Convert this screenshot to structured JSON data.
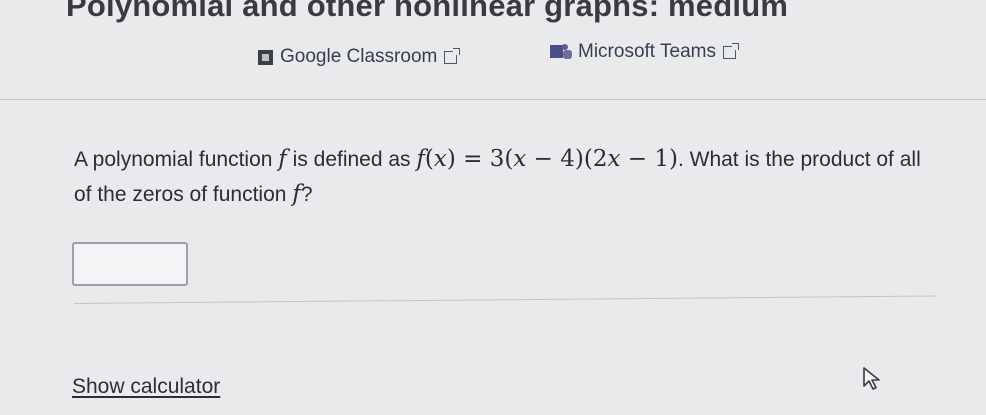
{
  "header": {
    "title": "Polynomial and other nonlinear graphs: medium"
  },
  "share": {
    "classroom": {
      "label": "Google Classroom",
      "icon": "google-classroom-icon"
    },
    "teams": {
      "label": "Microsoft Teams",
      "icon": "microsoft-teams-icon"
    }
  },
  "question": {
    "prefix": "A polynomial function ",
    "func_var": "f",
    "middle": " is defined as ",
    "suffix": ". What is the product of all of the zeros of function ",
    "end": "?"
  },
  "answer": {
    "value": "",
    "placeholder": ""
  },
  "footer": {
    "show_calculator": "Show calculator"
  },
  "colors": {
    "background": "#e9eaec",
    "text": "#2c2c38",
    "divider": "#c9cacf"
  }
}
